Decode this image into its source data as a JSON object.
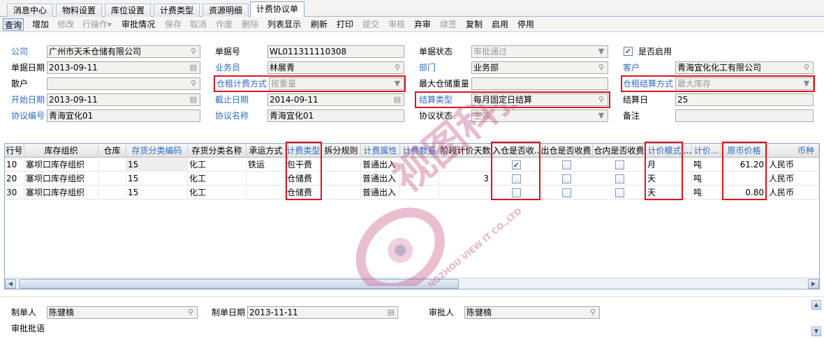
{
  "tabs": [
    "消息中心",
    "物料设置",
    "库位设置",
    "计费类型",
    "资源明细",
    "计费协议单"
  ],
  "toolbar": {
    "query": "查询",
    "add": "增加",
    "modify": "修改",
    "row_ops": "行操作",
    "row_ops_arrow": "▾",
    "approval_status": "审批情况",
    "save": "保存",
    "cancel": "取消",
    "void": "作废",
    "delete": "删除",
    "list_display": "列表显示",
    "refresh": "刷新",
    "print": "打印",
    "submit": "提交",
    "audit": "审核",
    "reject": "弃审",
    "renew": "续签",
    "copy": "复制",
    "enable": "启用",
    "disable": "停用"
  },
  "form": {
    "company_label": "公司",
    "company_value": "广州市天禾仓储有限公司",
    "bill_no_label": "单据号",
    "bill_no_value": "WL011311110308",
    "bill_status_label": "单据状态",
    "bill_status_value": "审批通过",
    "enabled_label": "是否启用",
    "enabled_check": "✓",
    "bill_date_label": "单据日期",
    "bill_date_value": "2013-09-11",
    "salesman_label": "业务员",
    "salesman_value": "林展青",
    "dept_label": "部门",
    "dept_value": "业务部",
    "customer_label": "客户",
    "customer_value": "青海宜化化工有限公司",
    "retail_label": "散户",
    "retail_value": "",
    "rent_method_label": "仓租计费方式",
    "rent_method_value": "按重量",
    "max_weight_label": "最大仓储重量",
    "max_weight_value": "",
    "rent_settle_label": "仓租结算方式",
    "rent_settle_value": "最大库存",
    "start_date_label": "开始日期",
    "start_date_value": "2013-09-11",
    "end_date_label": "截止日期",
    "end_date_value": "2014-09-11",
    "settle_type_label": "结算类型",
    "settle_type_value": "每月固定日结算",
    "settle_day_label": "结算日",
    "settle_day_value": "25",
    "agreement_no_label": "协议编号",
    "agreement_no_value": "青海宜化01",
    "agreement_name_label": "协议名称",
    "agreement_name_value": "青海宜化01",
    "agreement_status_label": "协议状态",
    "agreement_status_value": "生效",
    "remark_label": "备注",
    "remark_value": ""
  },
  "grid": {
    "headers": [
      "行号",
      "库存组织",
      "仓库",
      "存货分类编码",
      "存货分类名称",
      "承运方式",
      "计费类型",
      "拆分规则",
      "计费属性",
      "计费数量",
      "阶段计价天数",
      "入仓是否收...",
      "出仓是否收费",
      "仓内是否收费",
      "计价模式",
      "...",
      "计价...",
      "原币价格",
      "币种"
    ],
    "rows": [
      {
        "no": "10",
        "org": "塞坝口库存组织",
        "wh": "",
        "cat_code": "15",
        "cat_name": "化工",
        "transport": "铁运",
        "fee_type": "包干费",
        "split": "",
        "attr": "普通出入",
        "qty": "",
        "days": "",
        "in": "✓",
        "out": "",
        "inside": "",
        "mode": "月",
        "dots": "",
        "unit": "吨",
        "price": "61.20",
        "currency": "人民币"
      },
      {
        "no": "20",
        "org": "塞坝口库存组织",
        "wh": "",
        "cat_code": "15",
        "cat_name": "化工",
        "transport": "",
        "fee_type": "仓储费",
        "split": "",
        "attr": "普通出入",
        "qty": "",
        "days": "3",
        "in": "",
        "out": "",
        "inside": "",
        "mode": "天",
        "dots": "",
        "unit": "吨",
        "price": "",
        "currency": "人民币"
      },
      {
        "no": "30",
        "org": "塞坝口库存组织",
        "wh": "",
        "cat_code": "15",
        "cat_name": "化工",
        "transport": "",
        "fee_type": "仓储费",
        "split": "",
        "attr": "普通出入",
        "qty": "",
        "days": "",
        "in": "",
        "out": "",
        "inside": "",
        "mode": "天",
        "dots": "",
        "unit": "吨",
        "price": "0.80",
        "currency": "人民币"
      }
    ]
  },
  "bottom": {
    "maker_label": "制单人",
    "maker_value": "陈健楠",
    "make_date_label": "制单日期",
    "make_date_value": "2013-11-11",
    "approver_label": "审批人",
    "approver_value": "陈健楠",
    "approval_comment_label": "审批批语"
  },
  "watermark": {
    "text": "视图科技",
    "sub": "GUANGZHOU VIEW IT CO.,LTD"
  },
  "colors": {
    "accent": "#2b6cc4",
    "highlight_box": "#e0141c",
    "watermark": "#c2457a"
  }
}
